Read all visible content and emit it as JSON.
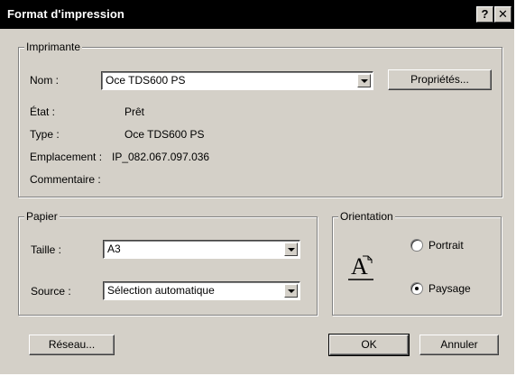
{
  "window": {
    "title": "Format d'impression",
    "help_label": "?",
    "close_label": "✕"
  },
  "printer": {
    "legend": "Imprimante",
    "name_label": "Nom :",
    "name_value": "Oce TDS600 PS",
    "properties_label": "Propriétés...",
    "status_label": "État :",
    "status_value": "Prêt",
    "type_label": "Type :",
    "type_value": "Oce TDS600 PS",
    "location_label": "Emplacement :",
    "location_value": "IP_082.067.097.036",
    "comment_label": "Commentaire :",
    "comment_value": ""
  },
  "paper": {
    "legend": "Papier",
    "size_label": "Taille :",
    "size_value": "A3",
    "source_label": "Source :",
    "source_value": "Sélection automatique"
  },
  "orientation": {
    "legend": "Orientation",
    "icon_letter": "A",
    "portrait_label": "Portrait",
    "landscape_label": "Paysage",
    "selected": "Paysage"
  },
  "buttons": {
    "network_label": "Réseau...",
    "ok_label": "OK",
    "cancel_label": "Annuler"
  }
}
